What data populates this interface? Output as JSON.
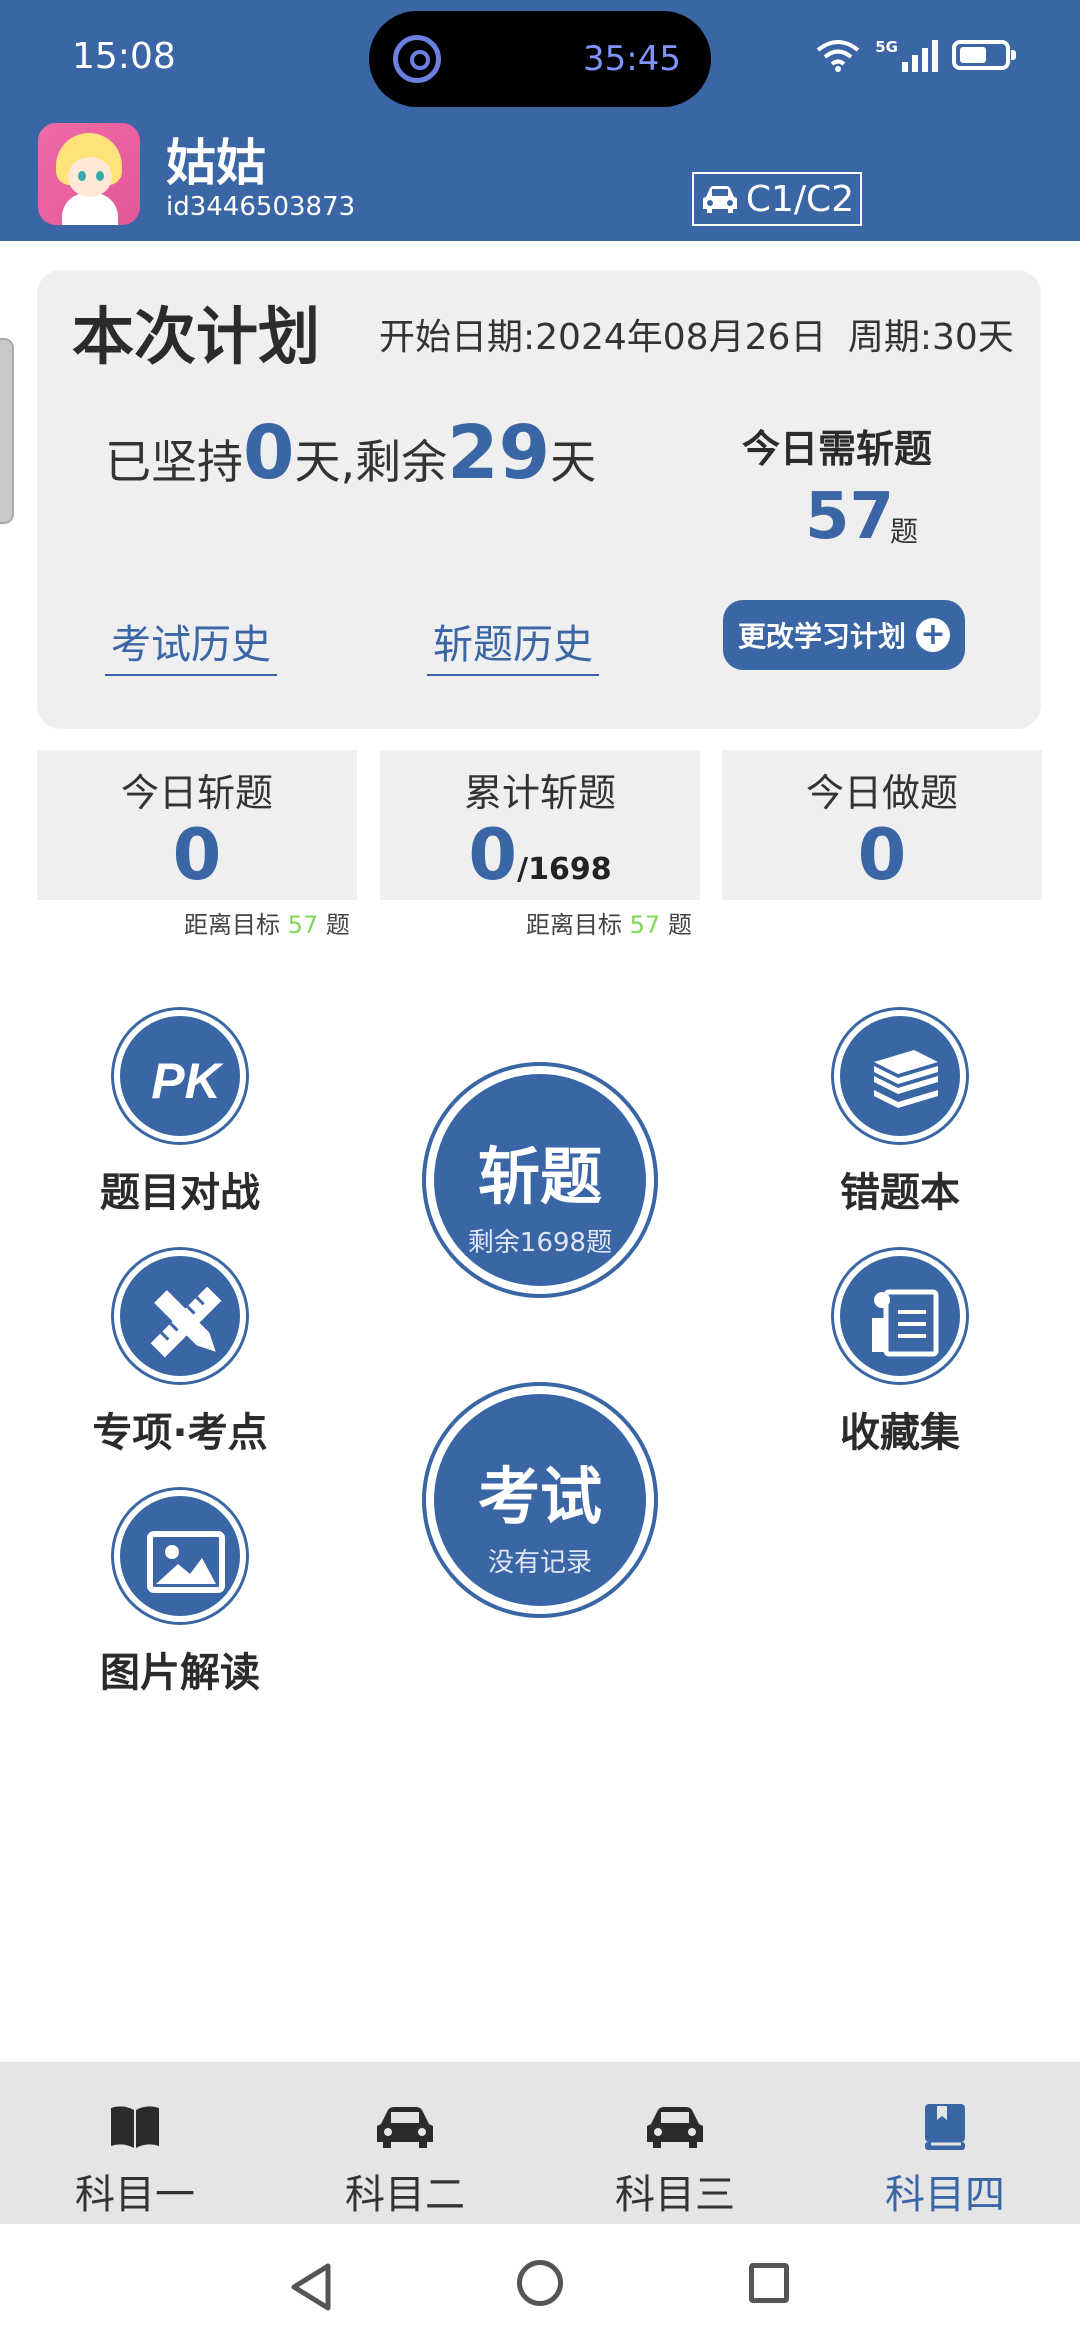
{
  "status_bar": {
    "time": "15:08",
    "island_timer": "35:45",
    "network": "5G"
  },
  "user": {
    "name": "姑姑",
    "id": "id3446503873",
    "license": "C1/C2"
  },
  "plan": {
    "title": "本次计划",
    "start_date_label": "开始日期:",
    "start_date": "2024年08月26日",
    "period_label": "周期:",
    "period": "30天",
    "persist_prefix": "已坚持",
    "persist_days": "0",
    "persist_mid": "天,剩余",
    "remaining_days": "29",
    "persist_suffix": "天",
    "today_need_label": "今日需斩题",
    "today_need_value": "57",
    "today_need_unit": "题",
    "exam_history": "考试历史",
    "cut_history": "斩题历史",
    "change_plan": "更改学习计划"
  },
  "stats": {
    "today_cut_label": "今日斩题",
    "today_cut_value": "0",
    "total_cut_label": "累计斩题",
    "total_cut_value": "0",
    "total_cut_total": "/1698",
    "today_done_label": "今日做题",
    "today_done_value": "0",
    "goal_prefix": "距离目标",
    "goal_value": "57",
    "goal_unit": "题"
  },
  "features": {
    "pk": "题目对战",
    "special": "专项·考点",
    "picture": "图片解读",
    "wrong_book": "错题本",
    "favorites": "收藏集"
  },
  "big_buttons": {
    "cut_title": "斩题",
    "cut_sub": "剩余1698题",
    "exam_title": "考试",
    "exam_sub": "没有记录"
  },
  "nav": {
    "items": [
      {
        "label": "科目一",
        "icon": "book-open-icon"
      },
      {
        "label": "科目二",
        "icon": "car-icon"
      },
      {
        "label": "科目三",
        "icon": "car-icon"
      },
      {
        "label": "科目四",
        "icon": "book-icon"
      }
    ],
    "active_index": 3
  },
  "colors": {
    "primary": "#3b66a6",
    "goal_green": "#7ed957",
    "card_bg": "#efefef"
  }
}
